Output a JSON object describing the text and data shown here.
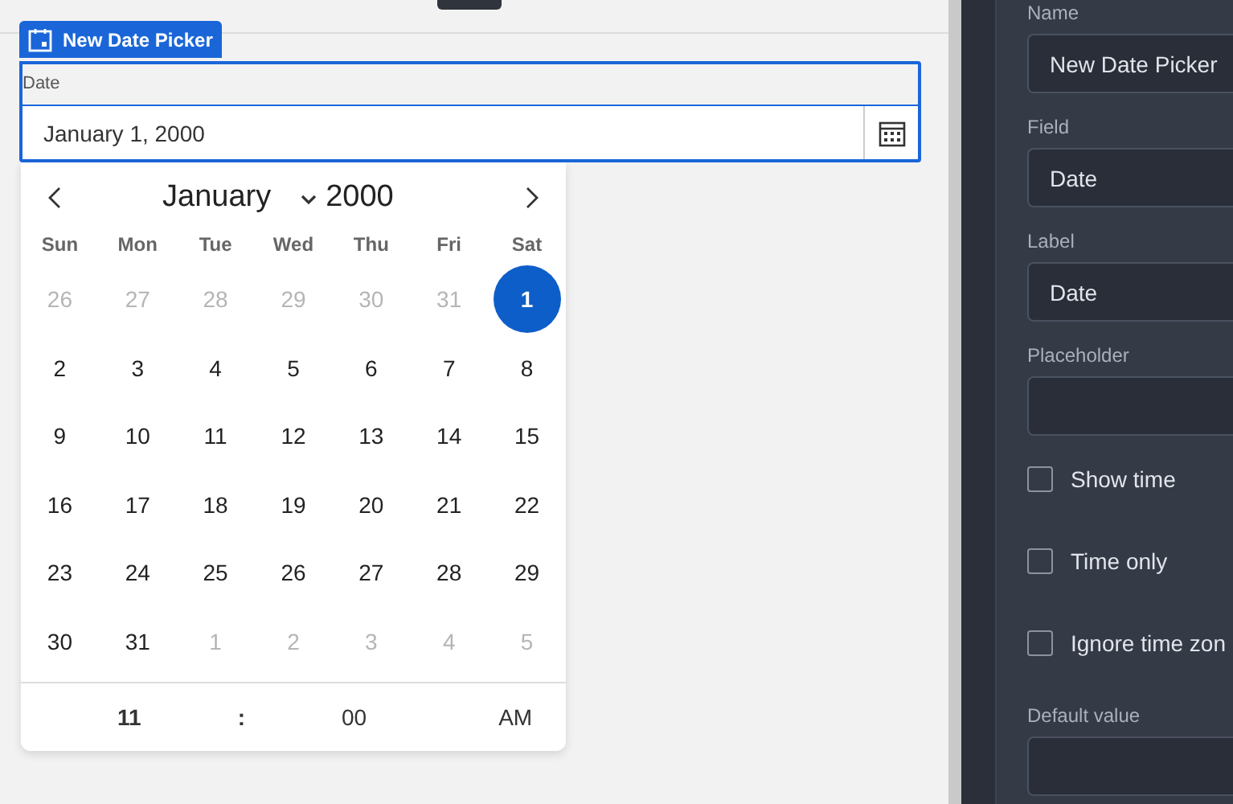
{
  "component": {
    "title": "New Date Picker",
    "label": "Date",
    "value": "January 1, 2000"
  },
  "calendar": {
    "month": "January",
    "year": "2000",
    "weekdays": [
      "Sun",
      "Mon",
      "Tue",
      "Wed",
      "Thu",
      "Fri",
      "Sat"
    ],
    "weeks": [
      [
        {
          "day": "26",
          "outside": true,
          "selected": false
        },
        {
          "day": "27",
          "outside": true,
          "selected": false
        },
        {
          "day": "28",
          "outside": true,
          "selected": false
        },
        {
          "day": "29",
          "outside": true,
          "selected": false
        },
        {
          "day": "30",
          "outside": true,
          "selected": false
        },
        {
          "day": "31",
          "outside": true,
          "selected": false
        },
        {
          "day": "1",
          "outside": false,
          "selected": true
        }
      ],
      [
        {
          "day": "2",
          "outside": false,
          "selected": false
        },
        {
          "day": "3",
          "outside": false,
          "selected": false
        },
        {
          "day": "4",
          "outside": false,
          "selected": false
        },
        {
          "day": "5",
          "outside": false,
          "selected": false
        },
        {
          "day": "6",
          "outside": false,
          "selected": false
        },
        {
          "day": "7",
          "outside": false,
          "selected": false
        },
        {
          "day": "8",
          "outside": false,
          "selected": false
        }
      ],
      [
        {
          "day": "9",
          "outside": false,
          "selected": false
        },
        {
          "day": "10",
          "outside": false,
          "selected": false
        },
        {
          "day": "11",
          "outside": false,
          "selected": false
        },
        {
          "day": "12",
          "outside": false,
          "selected": false
        },
        {
          "day": "13",
          "outside": false,
          "selected": false
        },
        {
          "day": "14",
          "outside": false,
          "selected": false
        },
        {
          "day": "15",
          "outside": false,
          "selected": false
        }
      ],
      [
        {
          "day": "16",
          "outside": false,
          "selected": false
        },
        {
          "day": "17",
          "outside": false,
          "selected": false
        },
        {
          "day": "18",
          "outside": false,
          "selected": false
        },
        {
          "day": "19",
          "outside": false,
          "selected": false
        },
        {
          "day": "20",
          "outside": false,
          "selected": false
        },
        {
          "day": "21",
          "outside": false,
          "selected": false
        },
        {
          "day": "22",
          "outside": false,
          "selected": false
        }
      ],
      [
        {
          "day": "23",
          "outside": false,
          "selected": false
        },
        {
          "day": "24",
          "outside": false,
          "selected": false
        },
        {
          "day": "25",
          "outside": false,
          "selected": false
        },
        {
          "day": "26",
          "outside": false,
          "selected": false
        },
        {
          "day": "27",
          "outside": false,
          "selected": false
        },
        {
          "day": "28",
          "outside": false,
          "selected": false
        },
        {
          "day": "29",
          "outside": false,
          "selected": false
        }
      ],
      [
        {
          "day": "30",
          "outside": false,
          "selected": false
        },
        {
          "day": "31",
          "outside": false,
          "selected": false
        },
        {
          "day": "1",
          "outside": true,
          "selected": false
        },
        {
          "day": "2",
          "outside": true,
          "selected": false
        },
        {
          "day": "3",
          "outside": true,
          "selected": false
        },
        {
          "day": "4",
          "outside": true,
          "selected": false
        },
        {
          "day": "5",
          "outside": true,
          "selected": false
        }
      ]
    ],
    "time": {
      "hour": "11",
      "separator": ":",
      "minute": "00",
      "period": "AM"
    }
  },
  "properties": [
    {
      "kind": "field",
      "label": "Name",
      "value": "New Date Picker"
    },
    {
      "kind": "field",
      "label": "Field",
      "value": "Date"
    },
    {
      "kind": "field",
      "label": "Label",
      "value": "Date"
    },
    {
      "kind": "field",
      "label": "Placeholder"
    },
    {
      "kind": "checkbox",
      "label": "Show time",
      "checked": false
    },
    {
      "kind": "checkbox",
      "label": "Time only",
      "checked": false
    },
    {
      "kind": "checkbox",
      "label": "Ignore time zon",
      "checked": false
    },
    {
      "kind": "field",
      "label": "Default value"
    }
  ]
}
